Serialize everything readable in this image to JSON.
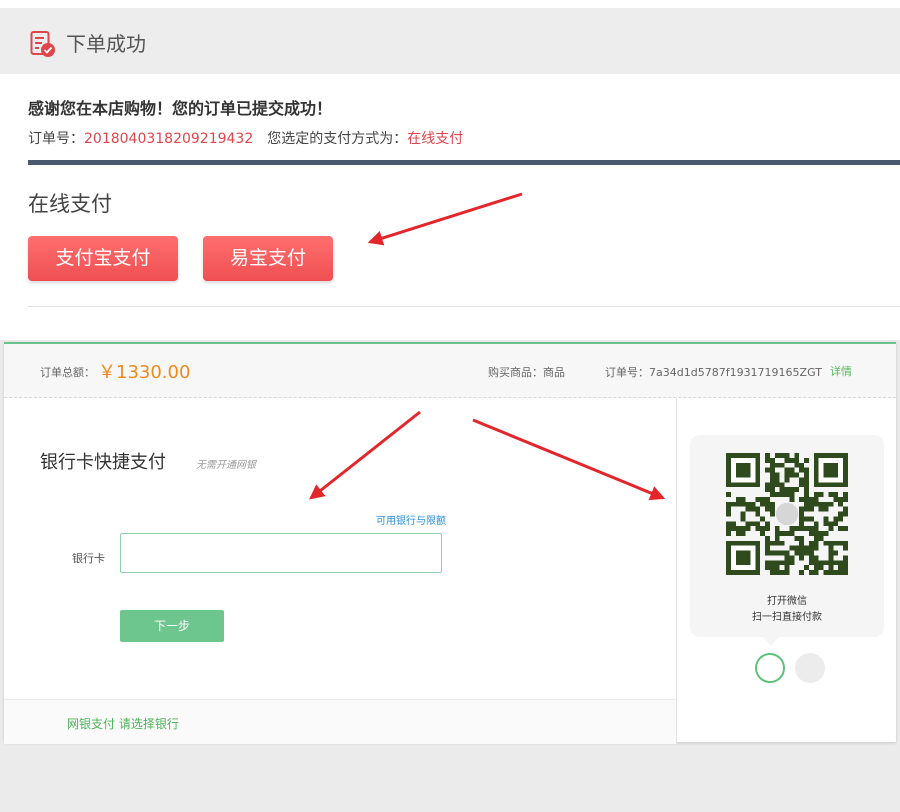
{
  "header": {
    "title": "下单成功",
    "icon": "order-success-icon"
  },
  "order_info": {
    "thanks": "感谢您在本店购物！您的订单已提交成功！",
    "order_no_label": "订单号：",
    "order_no": "2018040318209219432",
    "pay_method_label": "您选定的支付方式为：",
    "pay_method": "在线支付"
  },
  "online_pay": {
    "title": "在线支付",
    "buttons": [
      {
        "label": "支付宝支付"
      },
      {
        "label": "易宝支付"
      }
    ]
  },
  "cashier": {
    "total_label": "订单总额：",
    "total_amount": "￥1330.00",
    "goods": "购买商品：商品",
    "order_no": "订单号：7a34d1d5787f1931719165ZGT",
    "details_link": "详情",
    "bank_title": "银行卡快捷支付",
    "bank_subtitle": "无需开通网银",
    "limit_link": "可用银行与限额",
    "card_label": "银行卡",
    "card_input": {
      "value": "",
      "placeholder": ""
    },
    "next_button": "下一步",
    "netbank_link": "网银支付 请选择银行",
    "qr_line1": "打开微信",
    "qr_line2": "扫一扫直接付款"
  },
  "colors": {
    "accent_red": "#e0454b",
    "button_red": "#f25a5c",
    "green": "#6dc68e",
    "amount_orange": "#ee8a1c",
    "dark_bar": "#4b5a6e",
    "link_blue": "#2a8fd8",
    "annotation_arrow": "#e3262b"
  }
}
